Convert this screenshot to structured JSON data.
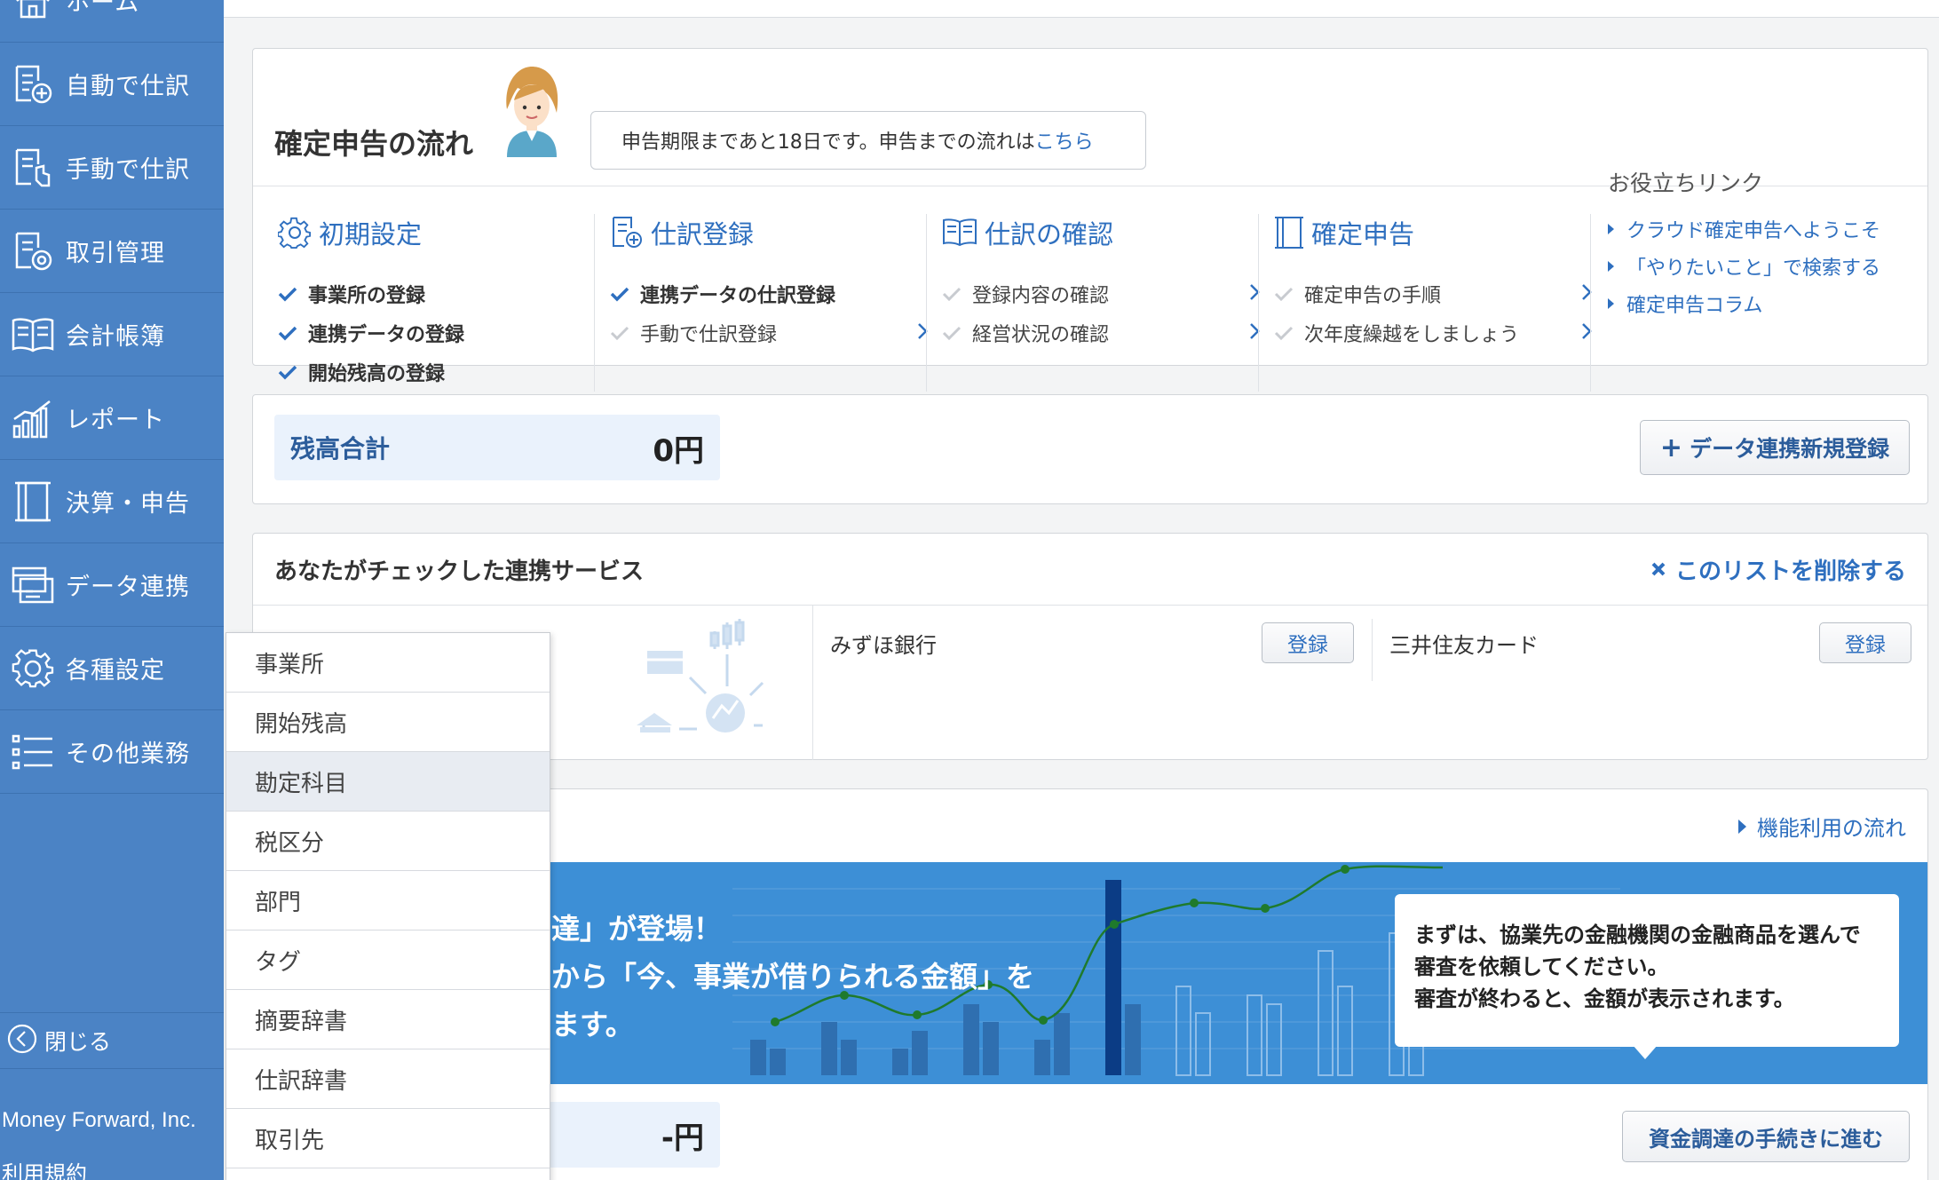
{
  "sidebar": {
    "items": [
      {
        "label": "ホーム",
        "icon": "home-icon"
      },
      {
        "label": "自動で仕訳",
        "icon": "auto-journal-icon"
      },
      {
        "label": "手動で仕訳",
        "icon": "manual-journal-icon"
      },
      {
        "label": "取引管理",
        "icon": "transaction-icon"
      },
      {
        "label": "会計帳簿",
        "icon": "ledger-book-icon"
      },
      {
        "label": "レポート",
        "icon": "report-chart-icon"
      },
      {
        "label": "決算・申告",
        "icon": "settlement-icon"
      },
      {
        "label": "データ連携",
        "icon": "data-link-icon"
      },
      {
        "label": "各種設定",
        "icon": "gear-icon"
      },
      {
        "label": "その他業務",
        "icon": "list-icon"
      }
    ],
    "close_label": "閉じる",
    "company": "Money Forward, Inc.",
    "terms": "利用規約"
  },
  "dropdown": {
    "items": [
      "事業所",
      "開始残高",
      "勘定科目",
      "税区分",
      "部門",
      "タグ",
      "摘要辞書",
      "仕訳辞書",
      "取引先"
    ],
    "active_index": 2
  },
  "flow": {
    "title": "確定申告の流れ",
    "notice_text": "申告期限まであと18日です。申告までの流れは",
    "notice_link": "こちら",
    "columns": [
      {
        "title": "初期設定",
        "icon": "gear-icon",
        "items": [
          {
            "label": "事業所の登録",
            "done": true
          },
          {
            "label": "連携データの登録",
            "done": true
          },
          {
            "label": "開始残高の登録",
            "done": true
          }
        ]
      },
      {
        "title": "仕訳登録",
        "icon": "journal-add-icon",
        "items": [
          {
            "label": "連携データの仕訳登録",
            "done": true
          },
          {
            "label": "手動で仕訳登録",
            "done": false
          }
        ]
      },
      {
        "title": "仕訳の確認",
        "icon": "book-icon",
        "items": [
          {
            "label": "登録内容の確認",
            "done": false
          },
          {
            "label": "経営状況の確認",
            "done": false
          }
        ]
      },
      {
        "title": "確定申告",
        "icon": "document-icon",
        "items": [
          {
            "label": "確定申告の手順",
            "done": false
          },
          {
            "label": "次年度繰越をしましょう",
            "done": false
          }
        ]
      }
    ],
    "links_title": "お役立ちリンク",
    "links": [
      "クラウド確定申告へようこそ",
      "「やりたいこと」で検索する",
      "確定申告コラム"
    ]
  },
  "balance": {
    "label": "残高合計",
    "value": "0円",
    "add_button": "データ連携新規登録"
  },
  "services": {
    "title": "あなたがチェックした連携サービス",
    "delete_label": "このリストを削除する",
    "list": [
      {
        "name": "みずほ銀行",
        "button": "登録"
      },
      {
        "name": "三井住友カード",
        "button": "登録"
      }
    ]
  },
  "finance": {
    "flow_link": "機能利用の流れ",
    "banner_lines": [
      "達」が登場！",
      "から「今、事業が借りられる金額」を",
      "ます。"
    ],
    "tip_lines": [
      "まずは、協業先の金融機関の金融商品を選んで",
      "審査を依頼してください。",
      "審査が終わると、金額が表示されます。"
    ],
    "amount": "-円",
    "proceed_button": "資金調達の手続きに進む"
  },
  "colors": {
    "sidebar": "#4b83c5",
    "accent": "#2e6fbf",
    "banner": "#3d8fd6"
  }
}
